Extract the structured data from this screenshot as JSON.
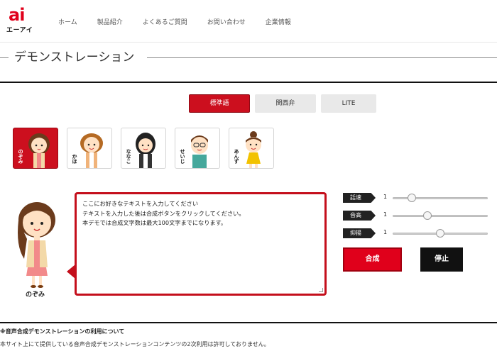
{
  "header": {
    "logo_mark": "ai",
    "logo_name": "エーアイ",
    "brand_color": "#e0001b",
    "nav": [
      "ホーム",
      "製品紹介",
      "よくあるご質問",
      "お問い合わせ",
      "企業情報"
    ]
  },
  "page_title": "デモンストレーション",
  "lang_tabs": [
    {
      "label": "標準語",
      "active": true
    },
    {
      "label": "関西弁",
      "active": false
    },
    {
      "label": "LITE",
      "active": false
    }
  ],
  "characters": [
    {
      "name": "のぞみ",
      "active": true
    },
    {
      "name": "かほ",
      "active": false
    },
    {
      "name": "ななこ",
      "active": false
    },
    {
      "name": "せいじ",
      "active": false
    },
    {
      "name": "あんず",
      "active": false
    }
  ],
  "selected_character": "のぞみ",
  "text_input": {
    "value": "ここにお好きなテキストを入力してください\nテキストを入力した後は合成ボタンをクリックしてください。\n本デモでは合成文字数は最大100文字までになります。"
  },
  "params": [
    {
      "label": "話速",
      "value": "1",
      "level": 0.17
    },
    {
      "label": "音高",
      "value": "1",
      "level": 0.35
    },
    {
      "label": "抑揚",
      "value": "1",
      "level": 0.5
    }
  ],
  "buttons": {
    "synth": "合成",
    "stop": "停止"
  },
  "notice": {
    "title": "※音声合成デモンストレーションの利用について",
    "body": "本サイト上にて提供している音声合成デモンストレーションコンテンツの2次利用は許可しておりません。"
  }
}
